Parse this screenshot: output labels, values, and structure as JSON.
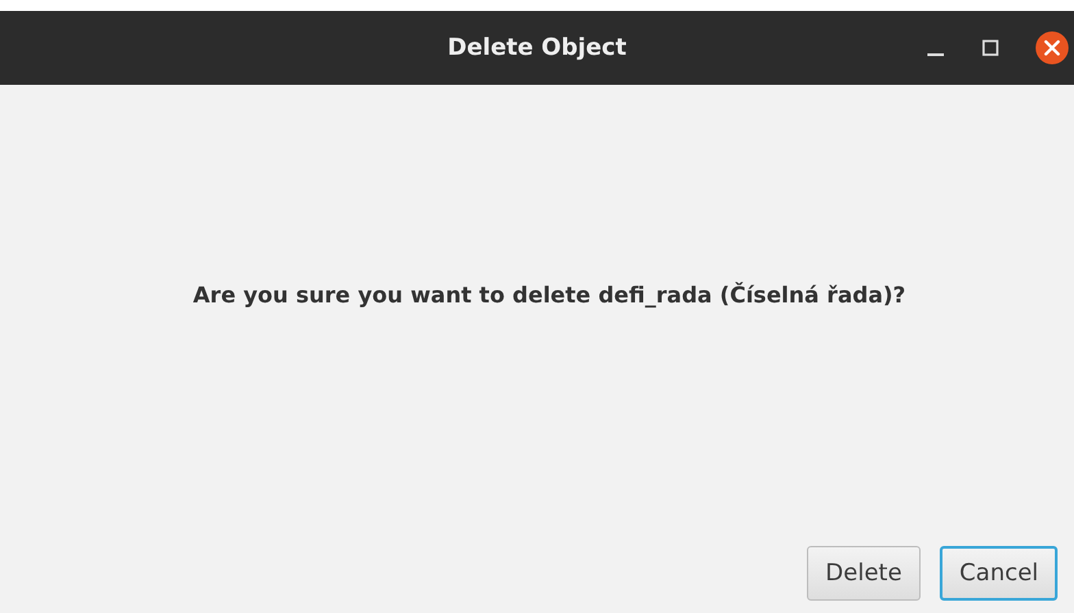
{
  "window": {
    "title": "Delete Object"
  },
  "message": "Are you sure you want to delete defi_rada (Číselná řada)?",
  "buttons": [
    {
      "label": "Delete",
      "focused": false
    },
    {
      "label": "Cancel",
      "focused": true
    }
  ]
}
